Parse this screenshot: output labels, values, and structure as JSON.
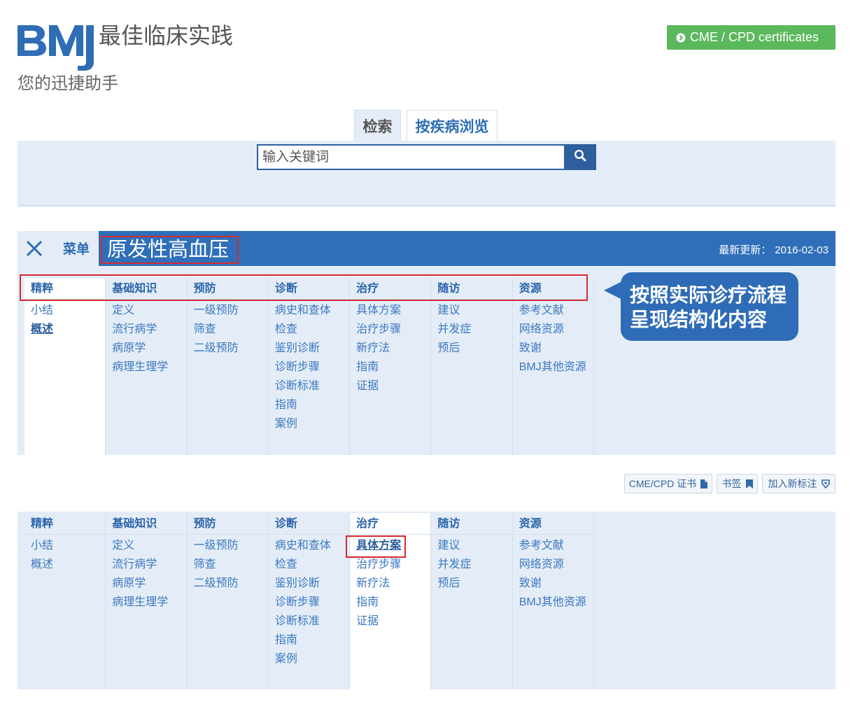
{
  "header": {
    "logo_text": "BMJ",
    "product_name": "最佳临床实践",
    "tagline": "您的迅捷助手",
    "cme_button_label": "CME / CPD certificates",
    "cme_button_icon": "circle-arrow-right-icon"
  },
  "search": {
    "tabs": [
      {
        "label": "检索",
        "active": true
      },
      {
        "label": "按疾病浏览",
        "active": false
      }
    ],
    "value": "",
    "placeholder": "输入关键词",
    "button_icon": "search-icon"
  },
  "topic_bar": {
    "toggle_icon": "close-icon",
    "menu_label": "菜单",
    "title": "原发性高血压",
    "updated_label": "最新更新：",
    "updated_date": "2016-02-03"
  },
  "menu": {
    "columns": [
      {
        "header": "精粹",
        "items": [
          "小结",
          "概述"
        ]
      },
      {
        "header": "基础知识",
        "items": [
          "定义",
          "流行病学",
          "病原学",
          "病理生理学"
        ]
      },
      {
        "header": "预防",
        "items": [
          "一级预防",
          "筛查",
          "二级预防"
        ]
      },
      {
        "header": "诊断",
        "items": [
          "病史和查体",
          "检查",
          "鉴别诊断",
          "诊断步骤",
          "诊断标准",
          "指南",
          "案例"
        ]
      },
      {
        "header": "治疗",
        "items": [
          "具体方案",
          "治疗步骤",
          "新疗法",
          "指南",
          "证据"
        ]
      },
      {
        "header": "随访",
        "items": [
          "建议",
          "并发症",
          "预后"
        ]
      },
      {
        "header": "资源",
        "items": [
          "参考文献",
          "网络资源",
          "致谢",
          "BMJ其他资源"
        ]
      }
    ]
  },
  "menu_states": [
    {
      "active_column": 0,
      "active_item": 1
    },
    {
      "active_column": 4,
      "active_item": 0
    }
  ],
  "callout": {
    "lines": [
      "按照实际诊疗流程",
      "呈现结构化内容"
    ]
  },
  "toolbar": {
    "buttons": [
      {
        "label": "CME/CPD 证书",
        "icon": "file-icon"
      },
      {
        "label": "书签",
        "icon": "bookmark-icon"
      },
      {
        "label": "加入新标注",
        "icon": "marker-down-icon"
      }
    ]
  },
  "colors": {
    "brand_blue": "#2f6fba",
    "link_blue": "#2e6cb6",
    "panel_bg": "#e4edf7",
    "cme_green": "#5cb85c",
    "highlight_red": "#d42a2f"
  }
}
